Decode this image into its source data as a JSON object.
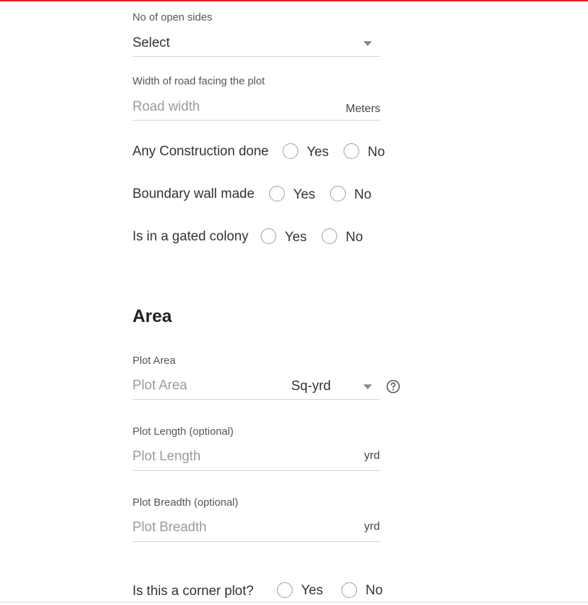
{
  "colors": {
    "accent": "#e31e24",
    "radio_border": "#9e9e9e",
    "placeholder": "#9a9a9a"
  },
  "open_sides": {
    "label": "No of open sides",
    "value": "Select",
    "icon": "chevron-down-icon"
  },
  "road_width": {
    "label": "Width of road facing the plot",
    "placeholder": "Road width",
    "unit": "Meters"
  },
  "questions": [
    {
      "label": "Any Construction done",
      "yes": "Yes",
      "no": "No"
    },
    {
      "label": "Boundary wall made",
      "yes": "Yes",
      "no": "No"
    },
    {
      "label": "Is in a gated colony",
      "yes": "Yes",
      "no": "No"
    }
  ],
  "area": {
    "title": "Area",
    "plot_area": {
      "label": "Plot Area",
      "placeholder": "Plot Area",
      "unit": "Sq-yrd",
      "help_icon": "question-circle-icon"
    },
    "plot_length": {
      "label": "Plot Length (optional)",
      "placeholder": "Plot Length",
      "unit": "yrd"
    },
    "plot_breadth": {
      "label": "Plot Breadth (optional)",
      "placeholder": "Plot Breadth",
      "unit": "yrd"
    }
  },
  "corner_plot": {
    "label": "Is this a corner plot?",
    "yes": "Yes",
    "no": "No"
  }
}
